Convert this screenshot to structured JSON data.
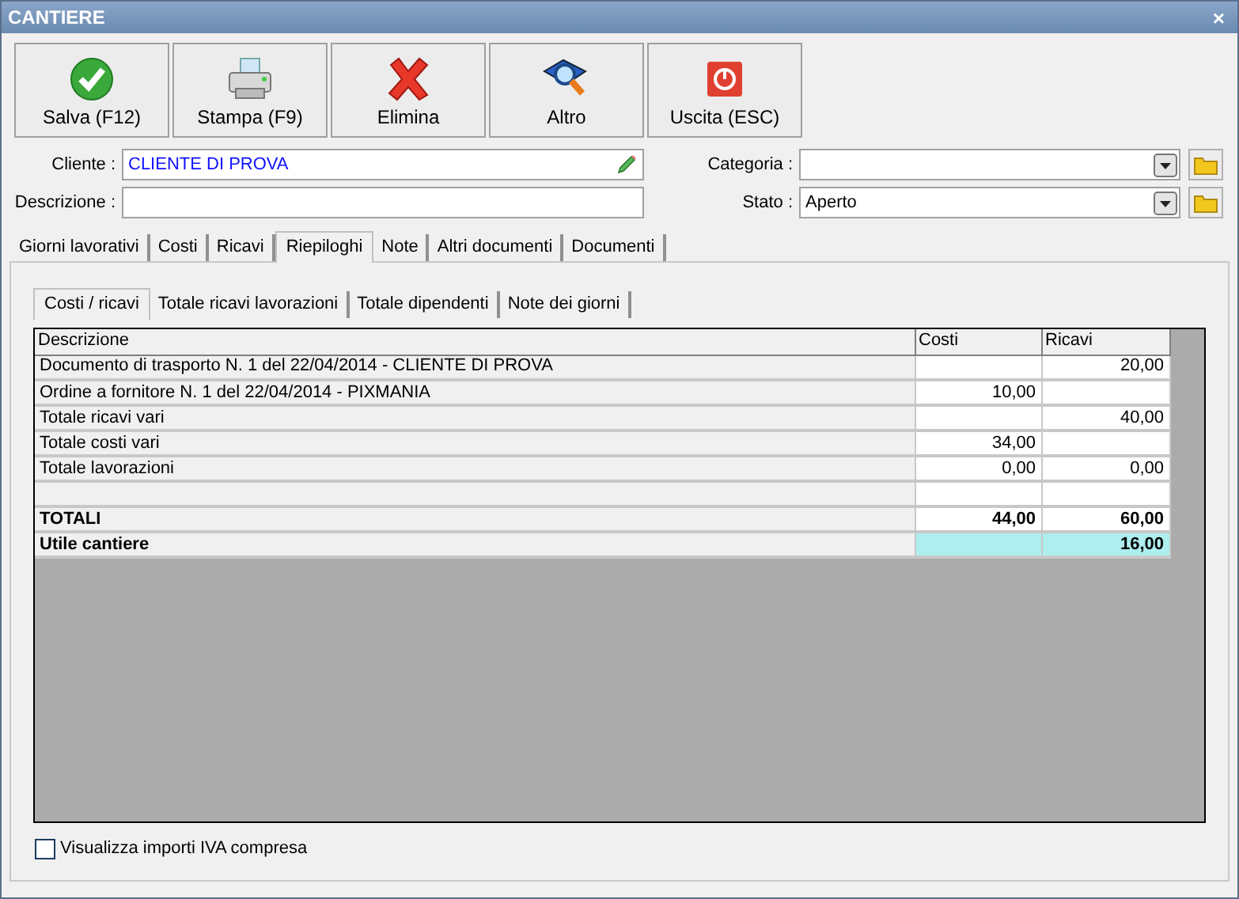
{
  "window": {
    "title": "CANTIERE",
    "close": "×"
  },
  "toolbar": [
    {
      "label": "Salva (F12)",
      "kind": "save"
    },
    {
      "label": "Stampa (F9)",
      "kind": "print"
    },
    {
      "label": "Elimina",
      "kind": "delete"
    },
    {
      "label": "Altro",
      "kind": "more"
    },
    {
      "label": "Uscita (ESC)",
      "kind": "exit"
    }
  ],
  "form": {
    "cliente": {
      "label": "Cliente :",
      "value": "CLIENTE DI PROVA"
    },
    "descrizione": {
      "label": "Descrizione :"
    },
    "categoria": {
      "label": "Categoria :"
    },
    "stato": {
      "label": "Stato :",
      "value": "Aperto"
    }
  },
  "tabs": [
    {
      "label": "Giorni lavorativi",
      "selected": false
    },
    {
      "label": "Costi",
      "selected": false
    },
    {
      "label": "Ricavi",
      "selected": false
    },
    {
      "label": "Riepiloghi",
      "selected": true
    },
    {
      "label": "Note",
      "selected": false
    },
    {
      "label": "Altri documenti",
      "selected": false
    },
    {
      "label": "Documenti",
      "selected": false
    }
  ],
  "subtabs": [
    {
      "label": "Costi / ricavi",
      "selected": true
    },
    {
      "label": "Totale ricavi lavorazioni",
      "selected": false
    },
    {
      "label": "Totale dipendenti",
      "selected": false
    },
    {
      "label": "Note dei giorni",
      "selected": false
    }
  ],
  "table": {
    "columns": [
      "Descrizione",
      "Costi",
      "Ricavi"
    ],
    "rows": [
      {
        "kind": "normal",
        "cells": [
          "Documento di trasporto N. 1 del 22/04/2014 - CLIENTE DI PROVA",
          "",
          "20,00"
        ]
      },
      {
        "kind": "normal",
        "cells": [
          "Ordine a fornitore N. 1 del 22/04/2014 - PIXMANIA",
          "10,00",
          ""
        ]
      },
      {
        "kind": "normal",
        "cells": [
          "Totale ricavi vari",
          "",
          "40,00"
        ]
      },
      {
        "kind": "normal",
        "cells": [
          "Totale costi vari",
          "34,00",
          ""
        ]
      },
      {
        "kind": "normal",
        "cells": [
          "Totale lavorazioni",
          "0,00",
          "0,00"
        ]
      },
      {
        "kind": "normal",
        "cells": [
          "",
          "",
          ""
        ]
      },
      {
        "kind": "total",
        "cells": [
          "TOTALI",
          "44,00",
          "60,00"
        ]
      },
      {
        "kind": "profit",
        "cells": [
          "Utile cantiere",
          "",
          "16,00"
        ]
      }
    ]
  },
  "iva_checkbox": {
    "label": "Visualizza importi IVA compresa",
    "checked": false
  }
}
